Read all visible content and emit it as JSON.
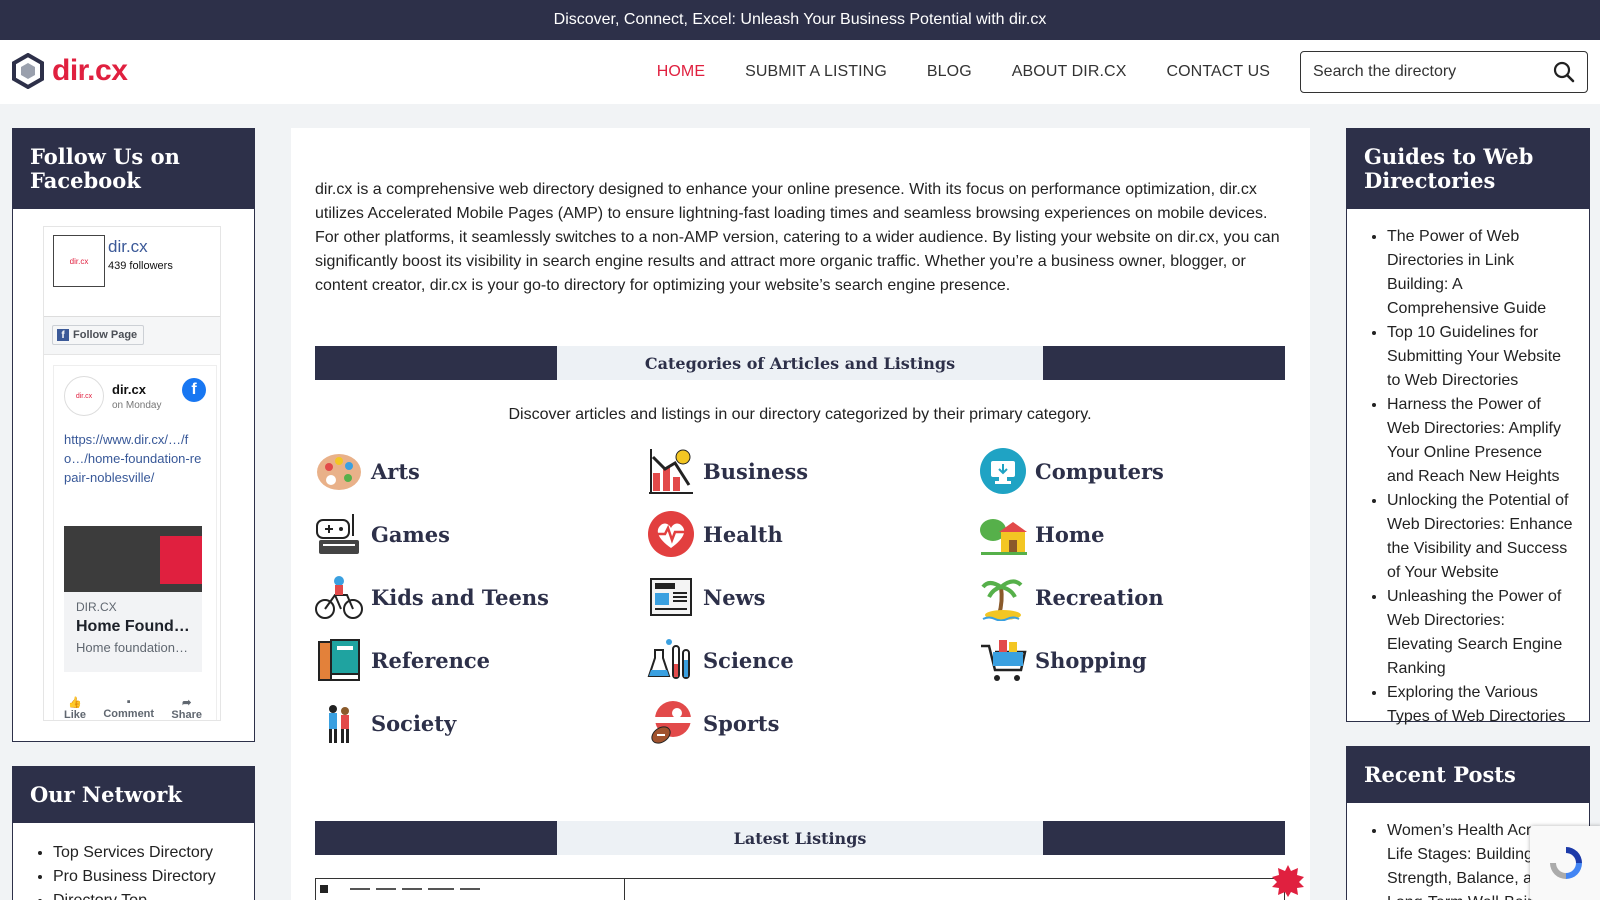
{
  "topbar": {
    "text": "Discover, Connect, Excel: Unleash Your Business Potential with dir.cx"
  },
  "header": {
    "logo_text": "dir.cx",
    "nav": [
      "HOME",
      "SUBMIT A LISTING",
      "BLOG",
      "ABOUT DIR.CX",
      "CONTACT US"
    ],
    "search_placeholder": "Search the directory"
  },
  "left": {
    "facebook": {
      "title": "Follow Us on Facebook",
      "page_name": "dir.cx",
      "followers": "439 followers",
      "follow_label": "Follow Page",
      "thumb_text": "dir.cx",
      "post_author": "dir.cx",
      "post_date": "on Monday",
      "post_link": "https://www.dir.cx/…/fo…/home-foundation-repair-noblesville/",
      "card_domain": "DIR.CX",
      "card_title": "Home Foundation Repair…",
      "card_desc": "Home foundation …",
      "actions": [
        "Like",
        "Comment",
        "Share"
      ]
    },
    "network": {
      "title": "Our Network",
      "items": [
        "Top Services Directory",
        "Pro Business Directory",
        "Directory Top"
      ]
    }
  },
  "main": {
    "intro": "dir.cx is a comprehensive web directory designed to enhance your online presence. With its focus on performance optimization, dir.cx utilizes Accelerated Mobile Pages (AMP) to ensure lightning-fast loading times and seamless browsing experiences on mobile devices. For other platforms, it seamlessly switches to a non-AMP version, catering to a wider audience. By listing your website on dir.cx, you can significantly boost its visibility in search engine results and attract more organic traffic. Whether you’re a business owner, blogger, or content creator, dir.cx is your go-to directory for optimizing your website’s search engine presence.",
    "categories_title": "Categories of Articles and Listings",
    "categories_sub": "Discover articles and listings in our directory categorized by their primary category.",
    "categories": [
      {
        "name": "Arts",
        "icon": "palette-icon"
      },
      {
        "name": "Business",
        "icon": "chart-icon"
      },
      {
        "name": "Computers",
        "icon": "computer-icon"
      },
      {
        "name": "Games",
        "icon": "game-console-icon"
      },
      {
        "name": "Health",
        "icon": "heart-icon"
      },
      {
        "name": "Home",
        "icon": "house-icon"
      },
      {
        "name": "Kids and Teens",
        "icon": "bicycle-icon"
      },
      {
        "name": "News",
        "icon": "newspaper-icon"
      },
      {
        "name": "Recreation",
        "icon": "palm-tree-icon"
      },
      {
        "name": "Reference",
        "icon": "books-icon"
      },
      {
        "name": "Science",
        "icon": "flask-icon"
      },
      {
        "name": "Shopping",
        "icon": "cart-icon"
      },
      {
        "name": "Society",
        "icon": "people-icon"
      },
      {
        "name": "Sports",
        "icon": "football-icon"
      }
    ],
    "latest_title": "Latest Listings"
  },
  "right": {
    "guides": {
      "title": "Guides to Web Directories",
      "items": [
        "The Power of Web Directories in Link Building: A Comprehensive Guide",
        "Top 10 Guidelines for Submitting Your Website to Web Directories",
        "Harness the Power of Web Directories: Amplify Your Online Presence and Reach New Heights",
        "Unlocking the Potential of Web Directories: Enhance the Visibility and Success of Your Website",
        "Unleashing the Power of Web Directories: Elevating Search Engine Ranking",
        "Exploring the Various Types of Web Directories"
      ]
    },
    "recent": {
      "title": "Recent Posts",
      "items": [
        "Women’s Health Across Life Stages: Building Strength, Balance, and Long-Term Well-Being"
      ]
    }
  },
  "colors": {
    "brand": "#e0203f",
    "navy": "#2d3049"
  }
}
